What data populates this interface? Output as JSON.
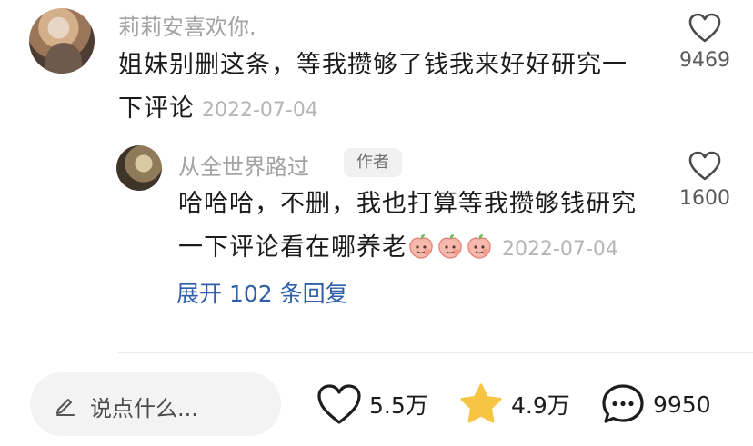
{
  "comment": {
    "username": "莉莉安喜欢你.",
    "text": "姐妹别删这条，等我攒够了钱我来好好研究一下评论",
    "date": "2022-07-04",
    "like_count": "9469"
  },
  "reply": {
    "username": "从全世界路过",
    "badge": "作者",
    "text": "哈哈哈，不删，我也打算等我攒够钱研究一下评论看在哪养老",
    "date": "2022-07-04",
    "like_count": "1600"
  },
  "expand_label": "展开 102 条回复",
  "bottom_bar": {
    "input_placeholder": "说点什么...",
    "like_count": "5.5万",
    "favorite_count": "4.9万",
    "comment_count": "9950"
  },
  "colors": {
    "link": "#2f5fa8",
    "star": "#f6c543",
    "muted_text": "#a3a3a3"
  },
  "icons": {
    "like": "heart-icon",
    "favorite": "star-icon",
    "comment": "chat-bubble-icon",
    "edit": "pen-icon",
    "emoji": "peach-emoji"
  }
}
